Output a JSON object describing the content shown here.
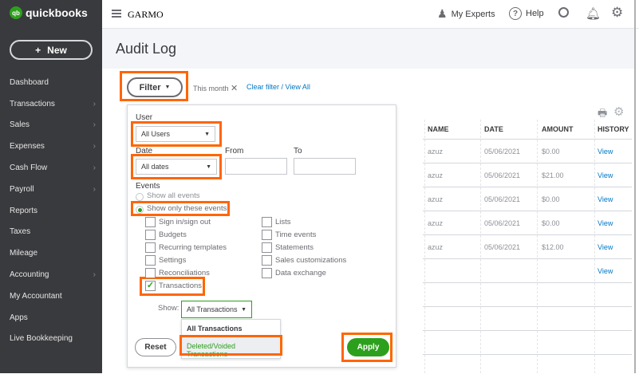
{
  "brand": {
    "logo_text": "quickbooks",
    "logo_badge": "qb",
    "accent": "#2ca01c",
    "highlight": "#ff6600"
  },
  "sidebar": {
    "new_label": "New",
    "items": [
      {
        "label": "Dashboard",
        "chevron": false
      },
      {
        "label": "Transactions",
        "chevron": true
      },
      {
        "label": "Sales",
        "chevron": true
      },
      {
        "label": "Expenses",
        "chevron": true
      },
      {
        "label": "Cash Flow",
        "chevron": true
      },
      {
        "label": "Payroll",
        "chevron": true
      },
      {
        "label": "Reports",
        "chevron": false
      },
      {
        "label": "Taxes",
        "chevron": false
      },
      {
        "label": "Mileage",
        "chevron": false
      },
      {
        "label": "Accounting",
        "chevron": true
      },
      {
        "label": "My Accountant",
        "chevron": false
      },
      {
        "label": "Apps",
        "chevron": false
      },
      {
        "label": "Live Bookkeeping",
        "chevron": false
      }
    ]
  },
  "topbar": {
    "company": "GARMO",
    "my_experts": "My Experts",
    "help": "Help"
  },
  "page": {
    "title": "Audit Log",
    "filter_label": "Filter",
    "this_month": "This month",
    "clear_filter": "Clear filter / View All"
  },
  "table": {
    "headers": [
      "NAME",
      "DATE",
      "AMOUNT",
      "HISTORY"
    ],
    "rows": [
      {
        "name": "azuz",
        "date": "05/06/2021",
        "amount": "$0.00",
        "history": "View"
      },
      {
        "name": "azuz",
        "date": "05/06/2021",
        "amount": "$21.00",
        "history": "View"
      },
      {
        "name": "azuz",
        "date": "05/06/2021",
        "amount": "$0.00",
        "history": "View"
      },
      {
        "name": "azuz",
        "date": "05/06/2021",
        "amount": "$0.00",
        "history": "View"
      },
      {
        "name": "azuz",
        "date": "05/06/2021",
        "amount": "$12.00",
        "history": "View"
      },
      {
        "name": "",
        "date": "",
        "amount": "",
        "history": "View"
      }
    ]
  },
  "filter": {
    "user_label": "User",
    "user_value": "All Users",
    "date_label": "Date",
    "date_value": "All dates",
    "from_label": "From",
    "to_label": "To",
    "from_value": "",
    "to_value": "",
    "events_label": "Events",
    "show_all": "Show all events",
    "show_only": "Show only these events",
    "checkboxes_left": [
      {
        "label": "Sign in/sign out",
        "checked": false
      },
      {
        "label": "Budgets",
        "checked": false
      },
      {
        "label": "Recurring templates",
        "checked": false
      },
      {
        "label": "Settings",
        "checked": false
      },
      {
        "label": "Reconciliations",
        "checked": false
      },
      {
        "label": "Transactions",
        "checked": true
      }
    ],
    "checkboxes_right": [
      {
        "label": "Lists",
        "checked": false
      },
      {
        "label": "Time events",
        "checked": false
      },
      {
        "label": "Statements",
        "checked": false
      },
      {
        "label": "Sales customizations",
        "checked": false
      },
      {
        "label": "Data exchange",
        "checked": false
      }
    ],
    "show_label": "Show:",
    "show_value": "All Transactions",
    "options": [
      "All Transactions",
      "Deleted/Voided Transactions"
    ],
    "reset": "Reset",
    "apply": "Apply"
  }
}
